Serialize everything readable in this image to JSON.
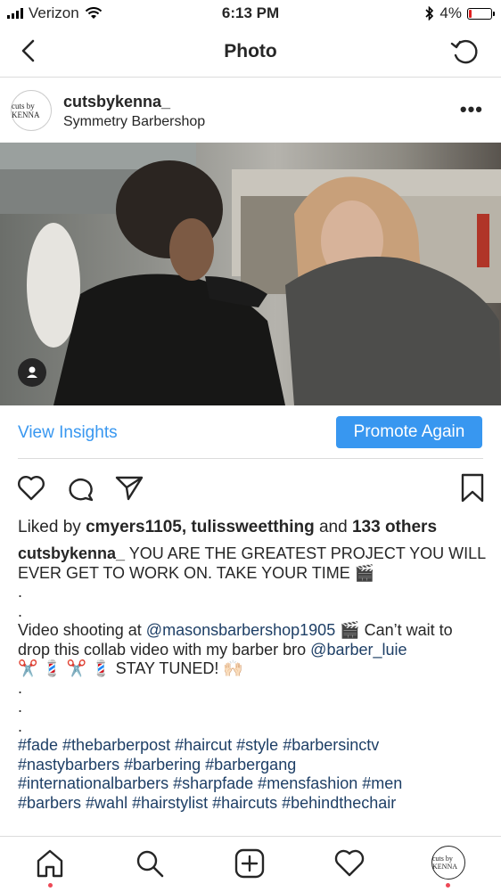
{
  "status_bar": {
    "carrier": "Verizon",
    "time": "6:13 PM",
    "battery": "4%",
    "battery_level": 0.04,
    "battery_color": "#e02020"
  },
  "nav": {
    "title": "Photo",
    "back_icon": "chevron-left-icon",
    "refresh_icon": "refresh-icon"
  },
  "post": {
    "username": "cutsbykenna_",
    "location": "Symmetry Barbershop",
    "avatar_text": "cuts by KENNA",
    "more_icon": "ellipsis-icon"
  },
  "insights": {
    "view_label": "View Insights",
    "promote_label": "Promote Again",
    "accent": "#3897f0"
  },
  "likes": {
    "prefix": "Liked by",
    "user1": "cmyers1105",
    "sep": ",",
    "user2": "tulissweetthing",
    "and": "and",
    "others": "133 others"
  },
  "caption": {
    "username": "cutsbykenna_",
    "line1": "YOU ARE THE GREATEST PROJECT YOU WILL EVER GET TO WORK ON. TAKE YOUR TIME 🎬",
    "dot": ".",
    "video_pre": "Video shooting at",
    "mention1": "@masonsbarbershop1905",
    "video_mid": "🎬 Can’t wait to drop this collab video with my barber bro",
    "mention2": "@barber_luie",
    "video_end": "✂️ 💈 ✂️ 💈 STAY TUNED! 🙌🏻",
    "hashtags_1": "#fade #thebarberpost #haircut #style #barbersinctv",
    "hashtags_2": "#nastybarbers #barbering #barbergang",
    "hashtags_3": "#internationalbarbers #sharpfade #mensfashion #men",
    "hashtags_4": "#barbers #wahl #hairstylist #haircuts #behindthechair"
  },
  "tabbar": {
    "items": [
      "home-icon",
      "search-icon",
      "add-post-icon",
      "activity-heart-icon",
      "profile-avatar"
    ],
    "notification_color": "#ed4956"
  }
}
